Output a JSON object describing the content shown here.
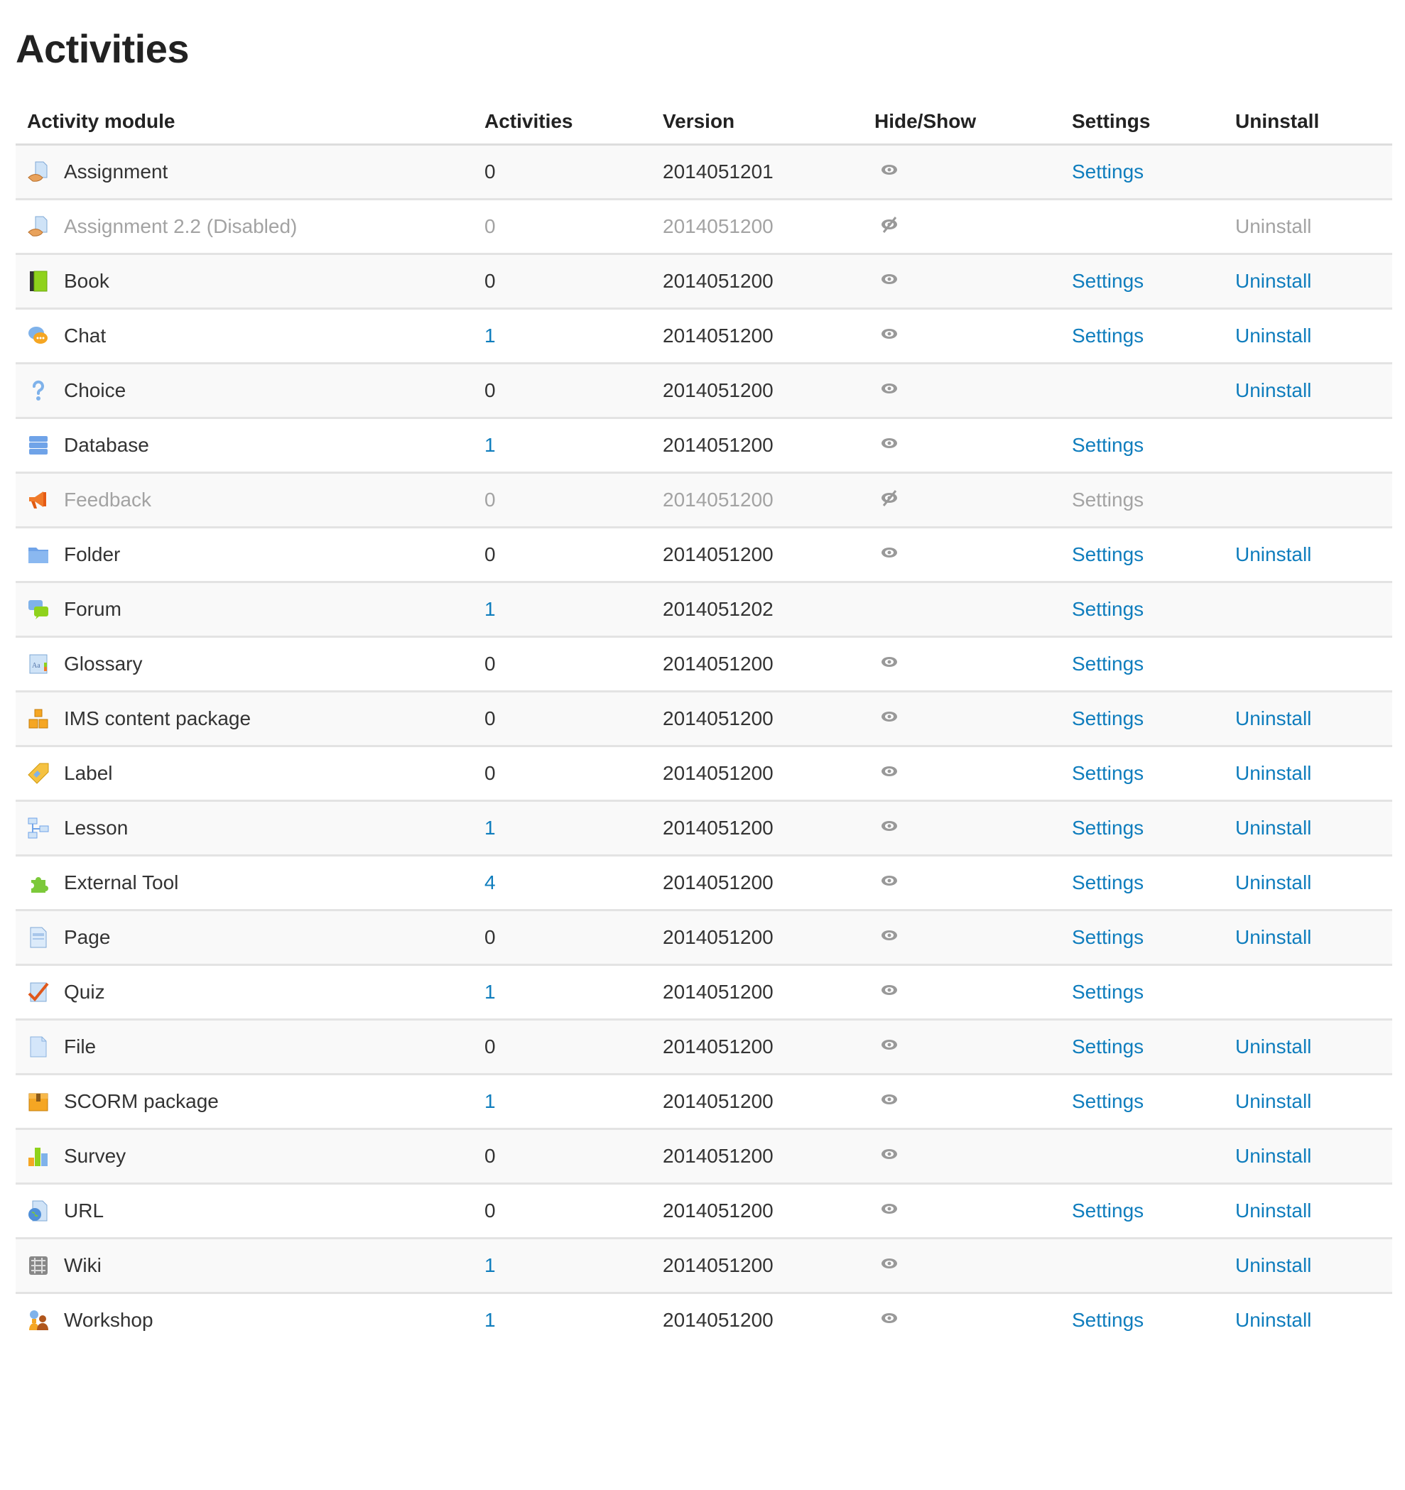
{
  "page": {
    "title": "Activities"
  },
  "table": {
    "headers": {
      "module": "Activity module",
      "activities": "Activities",
      "version": "Version",
      "hideshow": "Hide/Show",
      "settings": "Settings",
      "uninstall": "Uninstall"
    },
    "rows": [
      {
        "name": "Assignment",
        "icon": "assignment-icon",
        "count": "0",
        "count_link": false,
        "version": "2014051201",
        "visibility": "visible",
        "settings": "Settings",
        "uninstall": "",
        "dimmed": false
      },
      {
        "name": "Assignment 2.2 (Disabled)",
        "icon": "assignment-icon",
        "count": "0",
        "count_link": false,
        "version": "2014051200",
        "visibility": "hidden",
        "settings": "",
        "uninstall": "Uninstall",
        "dimmed": true
      },
      {
        "name": "Book",
        "icon": "book-icon",
        "count": "0",
        "count_link": false,
        "version": "2014051200",
        "visibility": "visible",
        "settings": "Settings",
        "uninstall": "Uninstall",
        "dimmed": false
      },
      {
        "name": "Chat",
        "icon": "chat-icon",
        "count": "1",
        "count_link": true,
        "version": "2014051200",
        "visibility": "visible",
        "settings": "Settings",
        "uninstall": "Uninstall",
        "dimmed": false
      },
      {
        "name": "Choice",
        "icon": "choice-icon",
        "count": "0",
        "count_link": false,
        "version": "2014051200",
        "visibility": "visible",
        "settings": "",
        "uninstall": "Uninstall",
        "dimmed": false
      },
      {
        "name": "Database",
        "icon": "database-icon",
        "count": "1",
        "count_link": true,
        "version": "2014051200",
        "visibility": "visible",
        "settings": "Settings",
        "uninstall": "",
        "dimmed": false
      },
      {
        "name": "Feedback",
        "icon": "feedback-icon",
        "count": "0",
        "count_link": false,
        "version": "2014051200",
        "visibility": "hidden",
        "settings": "Settings",
        "uninstall": "",
        "dimmed": true
      },
      {
        "name": "Folder",
        "icon": "folder-icon",
        "count": "0",
        "count_link": false,
        "version": "2014051200",
        "visibility": "visible",
        "settings": "Settings",
        "uninstall": "Uninstall",
        "dimmed": false
      },
      {
        "name": "Forum",
        "icon": "forum-icon",
        "count": "1",
        "count_link": true,
        "version": "2014051202",
        "visibility": "none",
        "settings": "Settings",
        "uninstall": "",
        "dimmed": false
      },
      {
        "name": "Glossary",
        "icon": "glossary-icon",
        "count": "0",
        "count_link": false,
        "version": "2014051200",
        "visibility": "visible",
        "settings": "Settings",
        "uninstall": "",
        "dimmed": false
      },
      {
        "name": "IMS content package",
        "icon": "ims-package-icon",
        "count": "0",
        "count_link": false,
        "version": "2014051200",
        "visibility": "visible",
        "settings": "Settings",
        "uninstall": "Uninstall",
        "dimmed": false
      },
      {
        "name": "Label",
        "icon": "label-icon",
        "count": "0",
        "count_link": false,
        "version": "2014051200",
        "visibility": "visible",
        "settings": "Settings",
        "uninstall": "Uninstall",
        "dimmed": false
      },
      {
        "name": "Lesson",
        "icon": "lesson-icon",
        "count": "1",
        "count_link": true,
        "version": "2014051200",
        "visibility": "visible",
        "settings": "Settings",
        "uninstall": "Uninstall",
        "dimmed": false
      },
      {
        "name": "External Tool",
        "icon": "external-tool-icon",
        "count": "4",
        "count_link": true,
        "version": "2014051200",
        "visibility": "visible",
        "settings": "Settings",
        "uninstall": "Uninstall",
        "dimmed": false
      },
      {
        "name": "Page",
        "icon": "page-icon",
        "count": "0",
        "count_link": false,
        "version": "2014051200",
        "visibility": "visible",
        "settings": "Settings",
        "uninstall": "Uninstall",
        "dimmed": false
      },
      {
        "name": "Quiz",
        "icon": "quiz-icon",
        "count": "1",
        "count_link": true,
        "version": "2014051200",
        "visibility": "visible",
        "settings": "Settings",
        "uninstall": "",
        "dimmed": false
      },
      {
        "name": "File",
        "icon": "file-icon",
        "count": "0",
        "count_link": false,
        "version": "2014051200",
        "visibility": "visible",
        "settings": "Settings",
        "uninstall": "Uninstall",
        "dimmed": false
      },
      {
        "name": "SCORM package",
        "icon": "scorm-package-icon",
        "count": "1",
        "count_link": true,
        "version": "2014051200",
        "visibility": "visible",
        "settings": "Settings",
        "uninstall": "Uninstall",
        "dimmed": false
      },
      {
        "name": "Survey",
        "icon": "survey-icon",
        "count": "0",
        "count_link": false,
        "version": "2014051200",
        "visibility": "visible",
        "settings": "",
        "uninstall": "Uninstall",
        "dimmed": false
      },
      {
        "name": "URL",
        "icon": "url-icon",
        "count": "0",
        "count_link": false,
        "version": "2014051200",
        "visibility": "visible",
        "settings": "Settings",
        "uninstall": "Uninstall",
        "dimmed": false
      },
      {
        "name": "Wiki",
        "icon": "wiki-icon",
        "count": "1",
        "count_link": true,
        "version": "2014051200",
        "visibility": "visible",
        "settings": "",
        "uninstall": "Uninstall",
        "dimmed": false
      },
      {
        "name": "Workshop",
        "icon": "workshop-icon",
        "count": "1",
        "count_link": true,
        "version": "2014051200",
        "visibility": "visible",
        "settings": "Settings",
        "uninstall": "Uninstall",
        "dimmed": false
      }
    ]
  },
  "colors": {
    "link": "#0f7dbd",
    "text": "#333333",
    "dimmed": "#a3a3a3",
    "row_stripe": "#f9f9f9",
    "eye_icon": "#999999"
  }
}
